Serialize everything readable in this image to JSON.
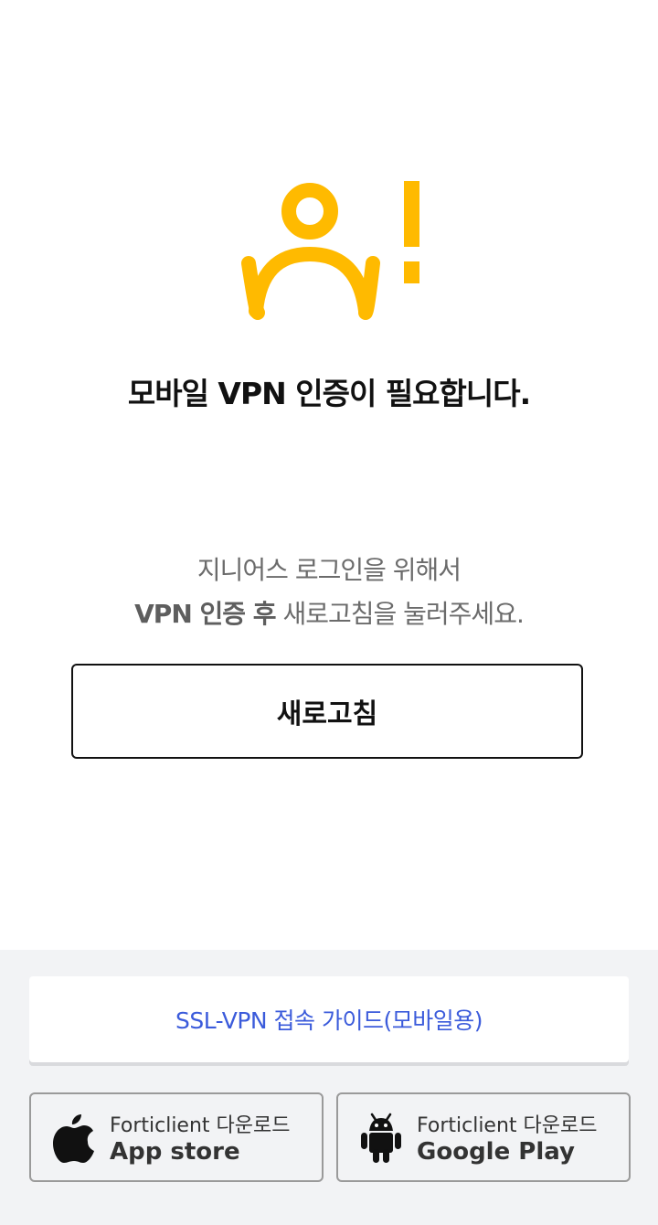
{
  "colors": {
    "accent": "#FFBA00",
    "link": "#3B5BDB",
    "text": "#111111",
    "muted": "#6B6B6B",
    "footer_bg": "#F2F3F5"
  },
  "hero": {
    "icon": "person-alert-icon",
    "title": "모바일 VPN 인증이 필요합니다."
  },
  "description": {
    "line1": "지니어스 로그인을 위해서",
    "line2_strong": "VPN 인증 후",
    "line2_rest": " 새로고침을 눌러주세요."
  },
  "refresh_button": {
    "label": "새로고침"
  },
  "footer": {
    "guide_link": "SSL-VPN 접속 가이드(모바일용)",
    "downloads": [
      {
        "icon": "apple-icon",
        "sub": "Forticlient 다운로드",
        "main": "App store"
      },
      {
        "icon": "android-icon",
        "sub": "Forticlient 다운로드",
        "main": "Google Play"
      }
    ]
  }
}
